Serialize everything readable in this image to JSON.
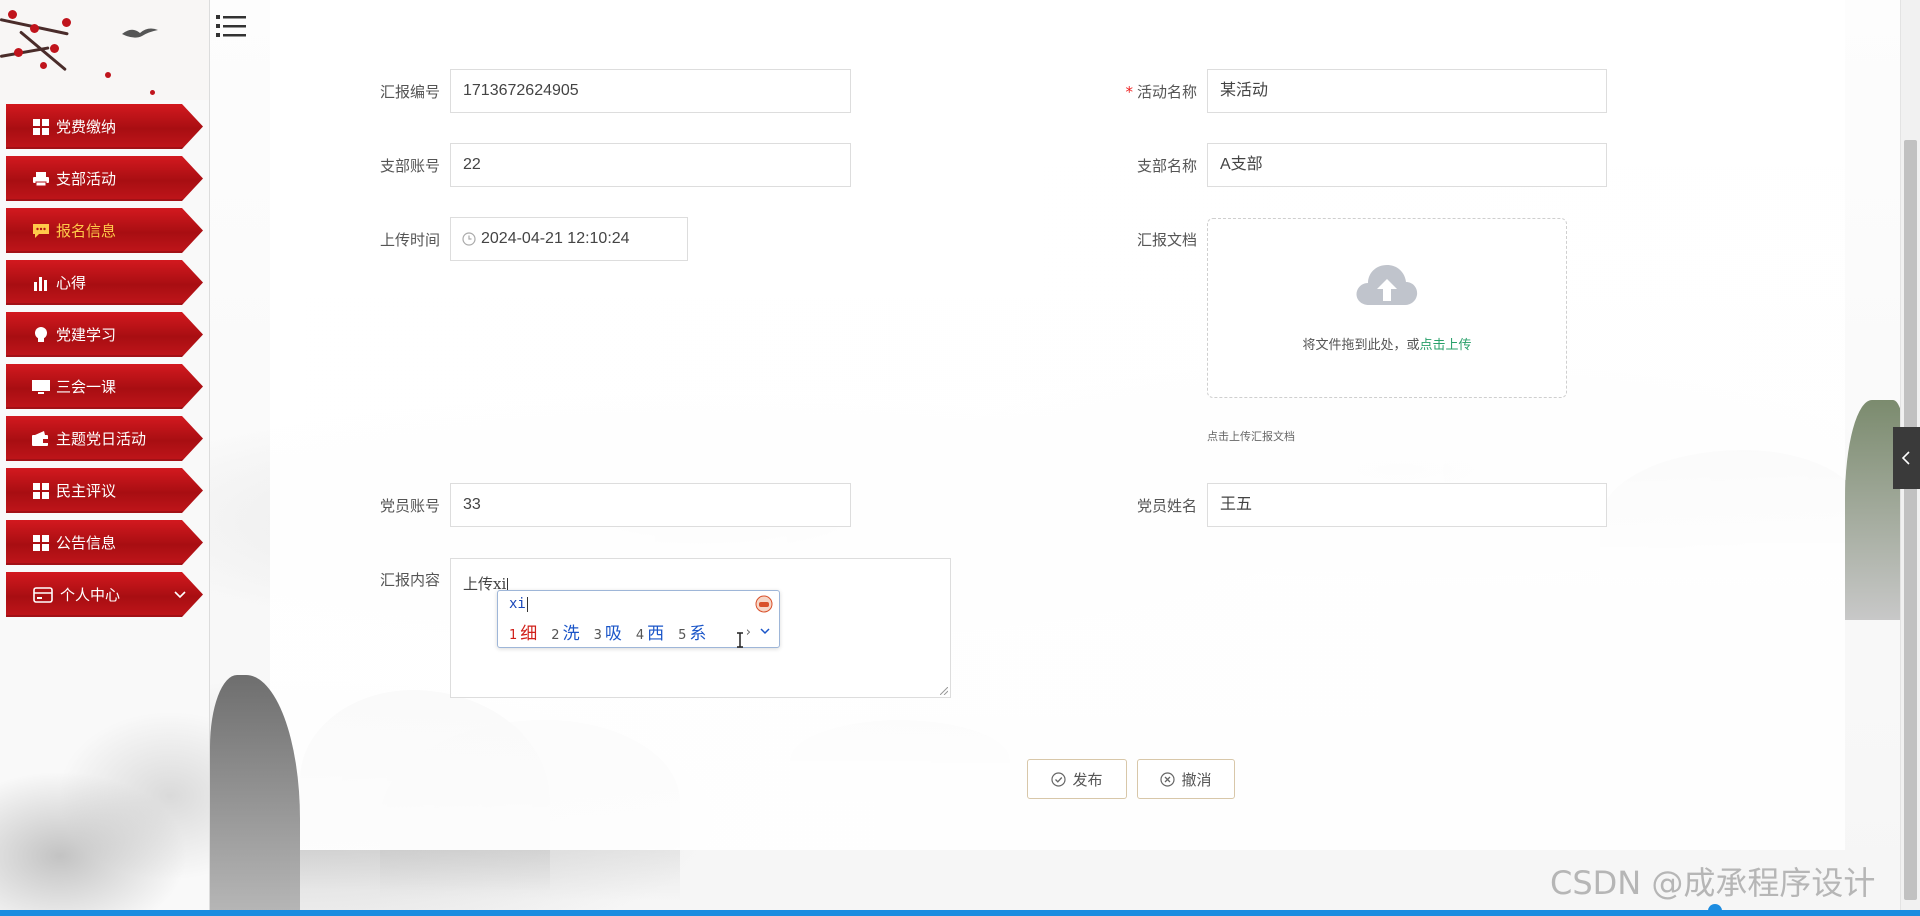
{
  "sidebar": {
    "items": [
      {
        "label": "党费缴纳",
        "icon": "grid-icon"
      },
      {
        "label": "支部活动",
        "icon": "printer-icon"
      },
      {
        "label": "报名信息",
        "icon": "chat-icon",
        "active": true
      },
      {
        "label": "心得",
        "icon": "bar-chart-icon"
      },
      {
        "label": "党建学习",
        "icon": "lightbulb-icon"
      },
      {
        "label": "三会一课",
        "icon": "monitor-icon"
      },
      {
        "label": "主题党日活动",
        "icon": "wallet-icon"
      },
      {
        "label": "民主评议",
        "icon": "grid-icon"
      },
      {
        "label": "公告信息",
        "icon": "grid-icon"
      },
      {
        "label": "个人中心",
        "icon": "card-icon",
        "expandable": true
      }
    ]
  },
  "form": {
    "report_no": {
      "label": "汇报编号",
      "value": "1713672624905"
    },
    "activity_name": {
      "label": "活动名称",
      "required_mark": "*",
      "value": "某活动"
    },
    "branch_account": {
      "label": "支部账号",
      "value": "22"
    },
    "branch_name": {
      "label": "支部名称",
      "value": "A支部"
    },
    "upload_time": {
      "label": "上传时间",
      "value": "2024-04-21 12:10:24"
    },
    "report_doc": {
      "label": "汇报文档",
      "drop_text": "将文件拖到此处，或",
      "link_text": "点击上传",
      "tip": "点击上传汇报文档"
    },
    "member_account": {
      "label": "党员账号",
      "value": "33"
    },
    "member_name": {
      "label": "党员姓名",
      "value": "王五"
    },
    "report_content": {
      "label": "汇报内容",
      "value": "上传xi"
    }
  },
  "ime": {
    "composition": "xi",
    "candidates": [
      {
        "num": "1",
        "text": "细"
      },
      {
        "num": "2",
        "text": "洗"
      },
      {
        "num": "3",
        "text": "吸"
      },
      {
        "num": "4",
        "text": "西"
      },
      {
        "num": "5",
        "text": "系"
      }
    ],
    "next_symbol": "›"
  },
  "buttons": {
    "publish": "发布",
    "cancel": "撤消"
  },
  "watermark": "CSDN @成承程序设计",
  "colors": {
    "menu_red": "#c0151a",
    "menu_active_text": "#ffc94a",
    "link_green": "#28a06a",
    "ime_blue": "#1a55c8"
  }
}
